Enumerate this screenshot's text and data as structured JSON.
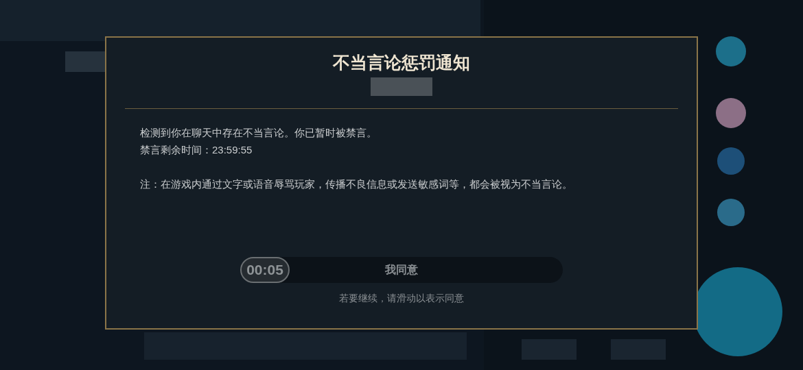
{
  "dialog": {
    "title": "不当言论惩罚通知",
    "message_lines": [
      "检测到你在聊天中存在不当言论。你已暂时被禁言。",
      "禁言剩余时间：23:59:55"
    ],
    "note": "注：在游戏内通过文字或语音辱骂玩家，传播不良信息或发送敏感词等，都会被视为不当言论。",
    "slider": {
      "countdown": "00:05",
      "label": "我同意",
      "level": 0,
      "disabled": true
    },
    "hint": "若要继续，请滑动以表示同意"
  }
}
